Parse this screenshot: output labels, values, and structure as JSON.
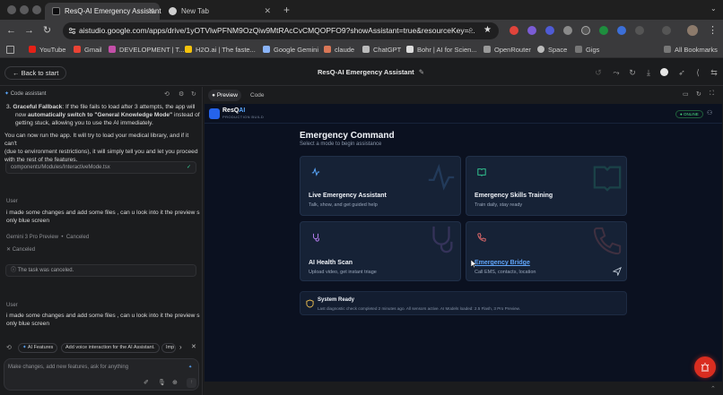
{
  "browser": {
    "tabs": [
      {
        "title": "ResQ-AI Emergency Assistant",
        "active": true
      },
      {
        "title": "New Tab",
        "active": false
      }
    ],
    "url": "aistudio.google.com/apps/drive/1yOTVlwPFNM9OzQiw9MtRAcCvCMQOPFO9?showAssistant=true&resourceKey=...",
    "bookmarks": [
      "YouTube",
      "Gmail",
      "DEVELOPMENT | T...",
      "H2O.ai | The faste...",
      "Google Gemini",
      "claude",
      "ChatGPT",
      "Bohr | AI for Scien...",
      "OpenRouter",
      "Space",
      "Gigs"
    ],
    "all_bookmarks": "All Bookmarks"
  },
  "studio": {
    "back_label": "Back to start",
    "app_title": "ResQ-AI Emergency Assistant",
    "tabs": {
      "preview": "Preview",
      "code": "Code"
    }
  },
  "assistant": {
    "label": "Code assistant",
    "item_number": "3.",
    "fallback_bold": "Graceful Fallback",
    "fallback_text1": ": If the file fails to load after 3 attempts, the app will",
    "fallback_text2": "now ",
    "fallback_bold2": "automatically switch to \"General Knowledge Mode\"",
    "fallback_text3": " instead of",
    "fallback_text4": "getting stuck, allowing you to use the AI immediately.",
    "para_line1": "You can now run the app. It will try to load your medical library, and if it can't",
    "para_line2": "(due to environment restrictions), it will simply tell you and let you proceed",
    "para_line3": "with the rest of the features.",
    "file_path": "components/Modules/InteractiveMode.tsx",
    "user_label_1": "User",
    "user_msg_1a": "i made some changes and add some files , can u look into it the preview s",
    "user_msg_1b": "only blue screen",
    "model_label": "Gemini 3 Pro Preview",
    "model_status": "Canceled",
    "canceled_label": "Canceled",
    "task_canceled": "The task was canceled.",
    "user_label_2": "User",
    "user_msg_2a": "i made some changes and add some files , can u look into it the preview s",
    "user_msg_2b": "only blue screen",
    "chips": [
      "AI Features",
      "Add voice interaction for the AI Assistant.",
      "Imp"
    ],
    "prompt_placeholder": "Make changes, add new features, ask for anything"
  },
  "resq": {
    "brand": "ResQ",
    "brand_ai": "AI",
    "build": "PRODUCTION BUILD",
    "online": "ONLINE",
    "heading": "Emergency Command",
    "subheading": "Select a mode to begin assistance",
    "cards": [
      {
        "title": "Live Emergency Assistant",
        "subtitle": "Talk, show, and get guided help",
        "accent": "#5aa9ff"
      },
      {
        "title": "Emergency Skills Training",
        "subtitle": "Train daily, stay ready",
        "accent": "#34d399"
      },
      {
        "title": "AI Health Scan",
        "subtitle": "Upload video, get instant triage",
        "accent": "#c084fc"
      },
      {
        "title": "Emergency Bridge",
        "subtitle": "Call EMS, contacts, location",
        "accent": "#f87171"
      }
    ],
    "status_title": "System Ready",
    "status_text": "Last diagnostic check completed 2 minutes ago. All sensors active. AI Models loaded: 2.5 Flash, 3 Pro Preview."
  },
  "colors": {
    "sos": "#d92d20",
    "online": "#22c55e",
    "accent": "#5aa9ff"
  }
}
